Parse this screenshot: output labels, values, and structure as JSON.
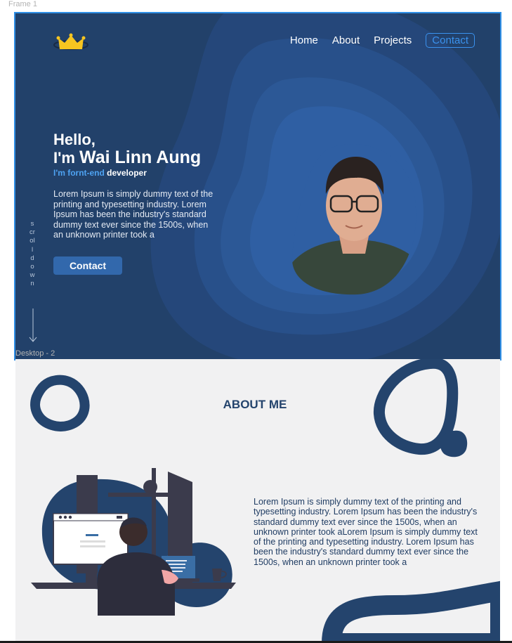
{
  "canvas": {
    "frame_label": "Frame 1",
    "desktop_label": "Desktop - 2"
  },
  "colors": {
    "hero_bg": "#22416a",
    "accent_blue": "#3a92ee",
    "selection_border": "#2f8fe6",
    "about_bg": "#f1f1f2",
    "dark_navy": "#24446d",
    "logo_yellow": "#f7c520"
  },
  "nav": {
    "logo_icon": "crown-logo-icon",
    "items": [
      "Home",
      "About",
      "Projects"
    ],
    "contact_label": "Contact"
  },
  "hero": {
    "greeting": "Hello,",
    "name_prefix": "I'm ",
    "name": "Wai Linn Aung",
    "role_highlight": "I'm fornt-end",
    "role_rest": " developer",
    "intro": "Lorem Ipsum is simply dummy text of the printing and typesetting industry. Lorem Ipsum has been the industry's standard dummy text ever since the 1500s, when an unknown printer took a",
    "contact_button": "Contact",
    "scroll_label": "scroll down",
    "scroll_icon": "arrow-down-icon",
    "portrait_icon": "profile-photo"
  },
  "about": {
    "title": "ABOUT ME",
    "body": "Lorem Ipsum is simply dummy text of the printing and typesetting industry. Lorem Ipsum has been the industry's standard dummy text ever since the 1500s, when an unknown printer took aLorem Ipsum is simply dummy text of the printing and typesetting industry. Lorem Ipsum has been the industry's standard dummy text ever since the 1500s, when an unknown printer took a",
    "illustration_icon": "developer-at-desk-illustration"
  }
}
